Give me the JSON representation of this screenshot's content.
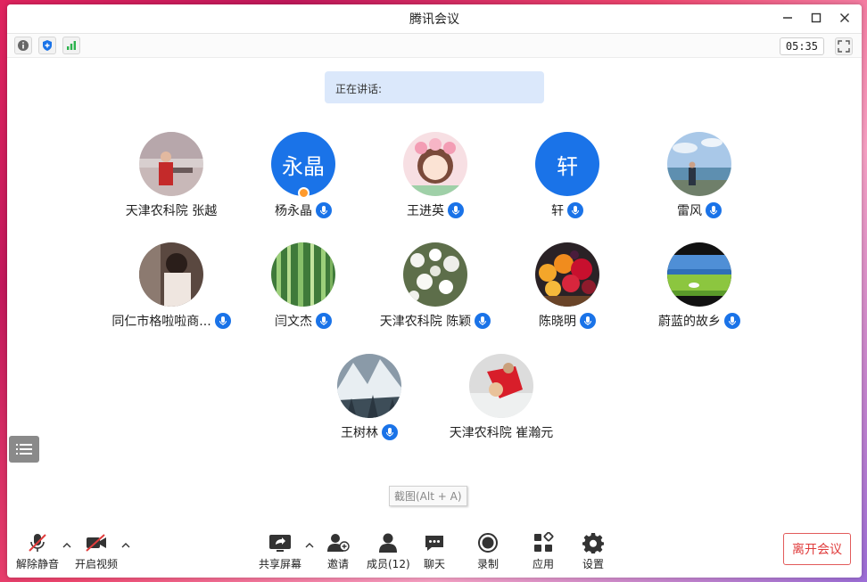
{
  "window": {
    "title": "腾讯会议"
  },
  "infobar": {
    "timer": "05:35"
  },
  "speaking": {
    "label": "正在讲话:"
  },
  "participants": [
    {
      "name": "天津农科院 张越",
      "avatar": "photo-person",
      "mic": false
    },
    {
      "name": "杨永晶",
      "avatar_text": "永晶",
      "mic": true,
      "host": true
    },
    {
      "name": "王进英",
      "avatar": "photo-cartoon-girl",
      "mic": true
    },
    {
      "name": "轩",
      "avatar_text": "轩",
      "mic": true
    },
    {
      "name": "雷风",
      "avatar": "photo-sea",
      "mic": true
    },
    {
      "name": "同仁市格啦啦商...",
      "avatar": "photo-dark",
      "mic": true
    },
    {
      "name": "闫文杰",
      "avatar": "photo-bamboo",
      "mic": true
    },
    {
      "name": "天津农科院 陈颖",
      "avatar": "photo-flowers",
      "mic": true
    },
    {
      "name": "陈晓明",
      "avatar": "photo-fruit",
      "mic": true
    },
    {
      "name": "蔚蓝的故乡",
      "avatar": "photo-grassland",
      "mic": true
    },
    {
      "name": "王树林",
      "avatar": "photo-snow-mountain",
      "mic": true
    },
    {
      "name": "天津农科院 崔瀚元",
      "avatar": "photo-red-coat",
      "mic": false
    }
  ],
  "tooltip": {
    "text": "截图(Alt + A)"
  },
  "toolbar": {
    "unmute": "解除静音",
    "start_video": "开启视频",
    "share_screen": "共享屏幕",
    "invite": "邀请",
    "members": "成员(12)",
    "chat": "聊天",
    "record": "录制",
    "apps": "应用",
    "settings": "设置",
    "leave": "离开会议"
  },
  "colors": {
    "accent": "#1a73e8",
    "leave": "#e03c3c",
    "speaking_bg": "#dbe8fb"
  }
}
